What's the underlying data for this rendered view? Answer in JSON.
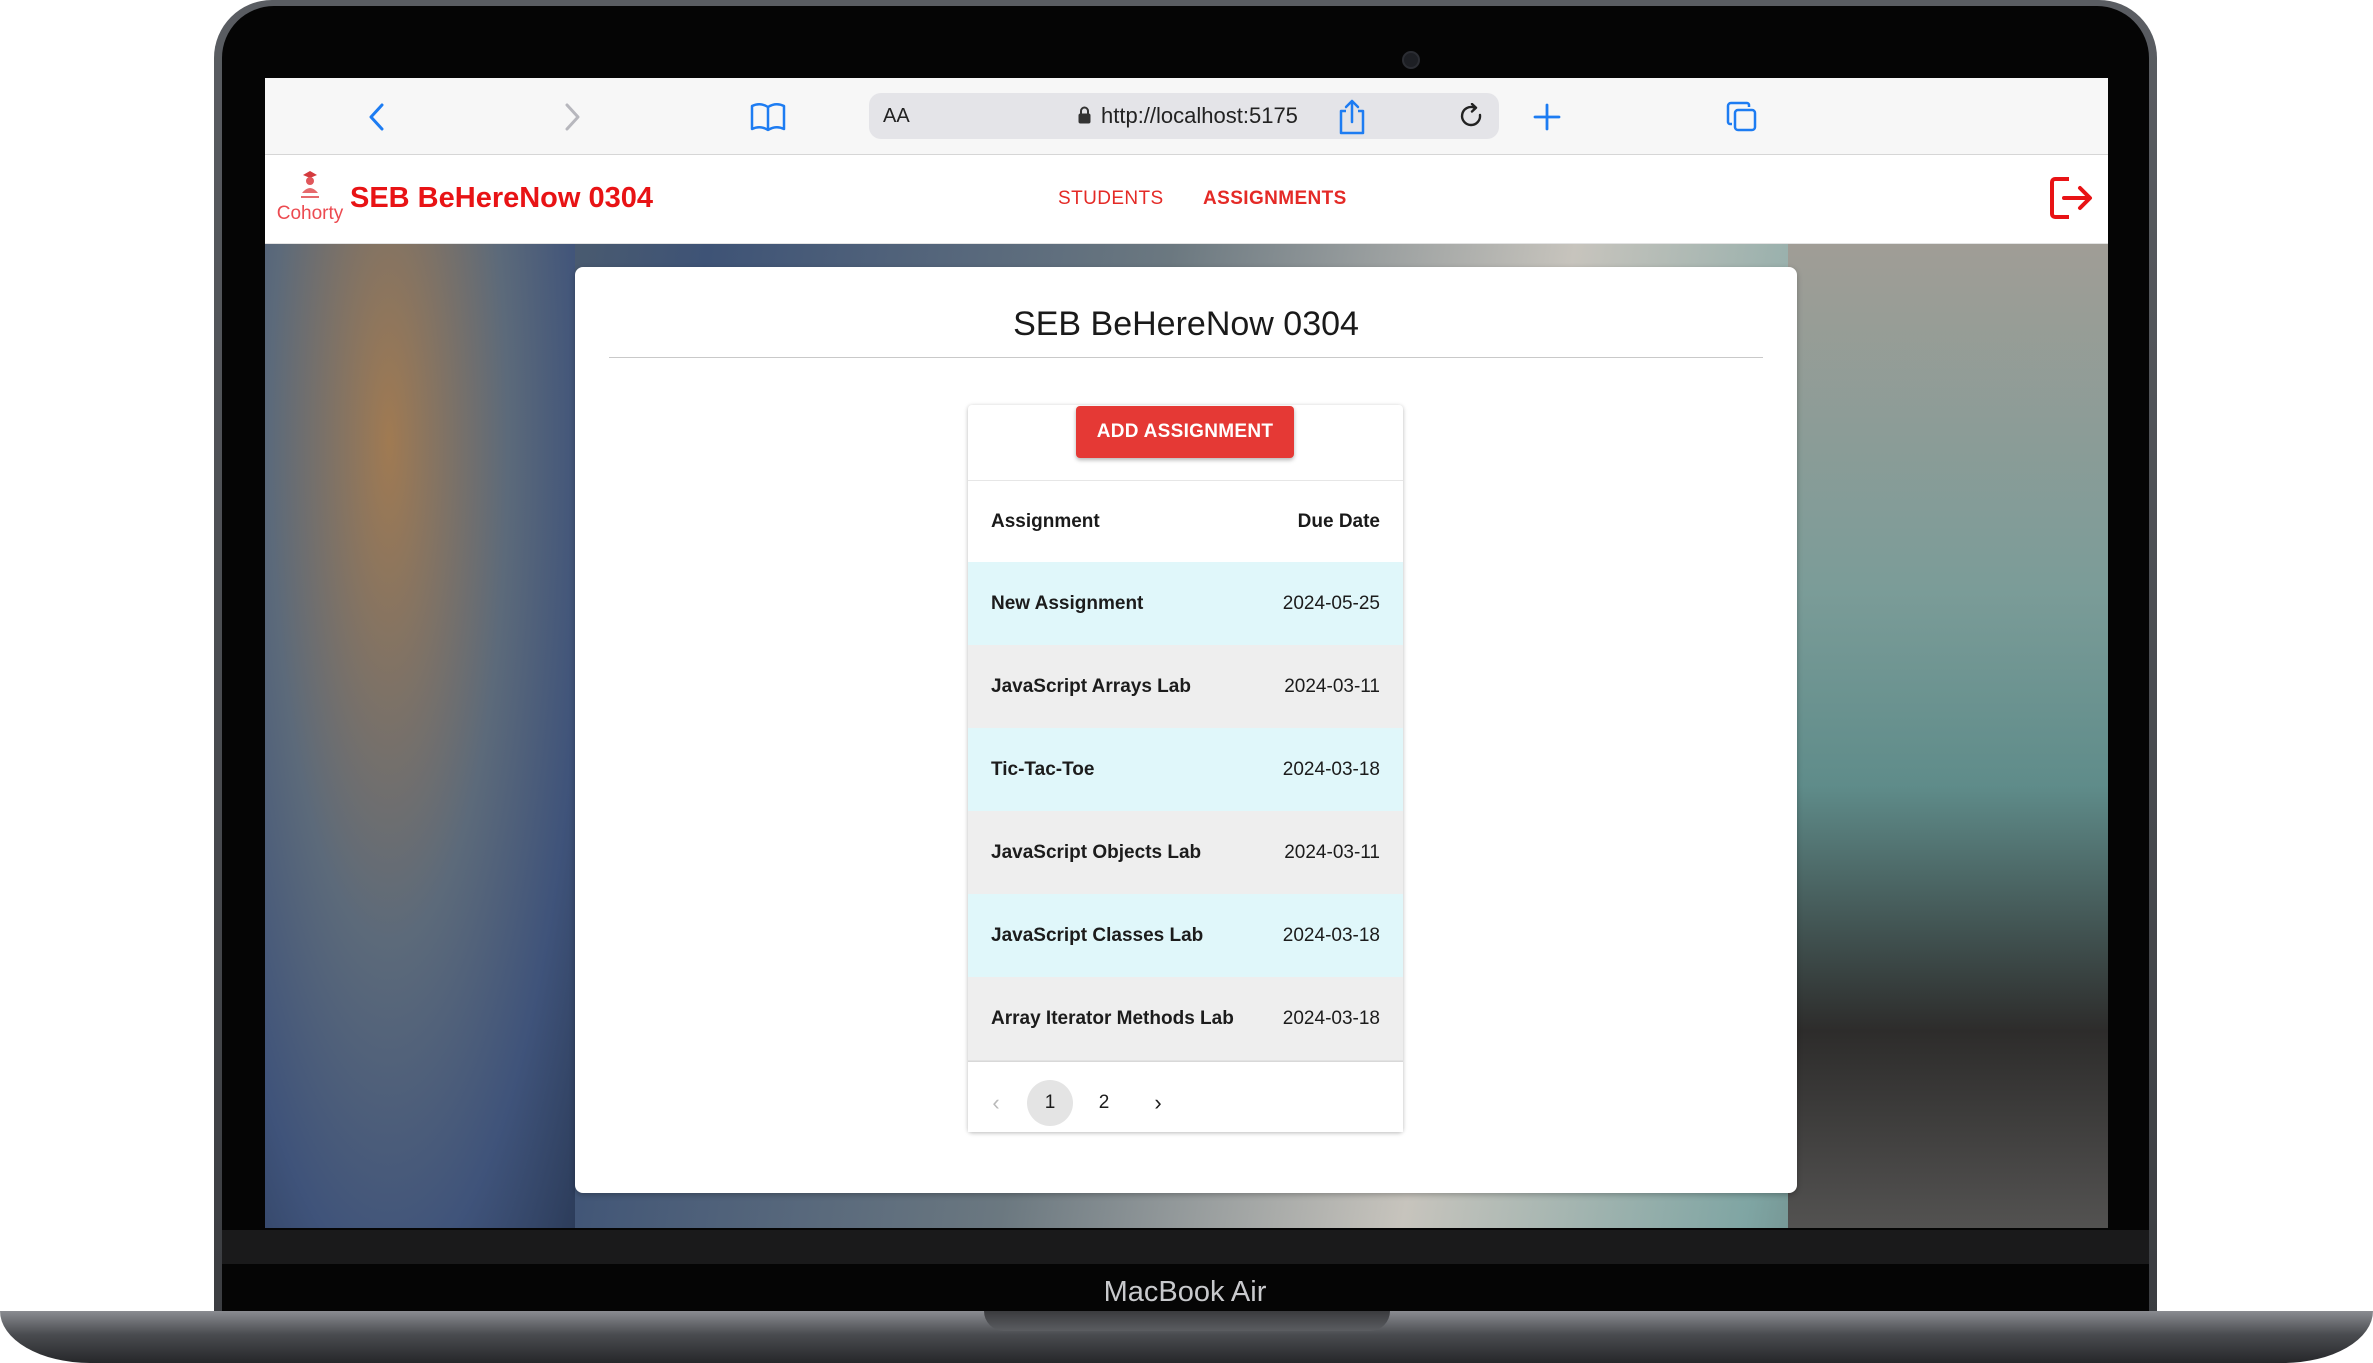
{
  "device": {
    "brand_label": "MacBook Air"
  },
  "browser": {
    "text_size_label": "AA",
    "url": "http://localhost:5175",
    "icons": [
      "back-icon",
      "forward-icon",
      "bookmarks-icon",
      "lock-icon",
      "reload-icon",
      "share-icon",
      "new-tab-icon",
      "tabs-icon"
    ]
  },
  "app": {
    "logo_text": "Cohorty",
    "title": "SEB BeHereNow 0304",
    "nav": {
      "students": "STUDENTS",
      "assignments": "ASSIGNMENTS"
    },
    "accent_color": "#e81315"
  },
  "main": {
    "card_title": "SEB BeHereNow 0304",
    "add_button_label": "ADD ASSIGNMENT",
    "table": {
      "headers": {
        "assignment": "Assignment",
        "due_date": "Due Date"
      },
      "rows": [
        {
          "name": "New Assignment",
          "due": "2024-05-25"
        },
        {
          "name": "JavaScript Arrays Lab",
          "due": "2024-03-11"
        },
        {
          "name": "Tic-Tac-Toe",
          "due": "2024-03-18"
        },
        {
          "name": "JavaScript Objects Lab",
          "due": "2024-03-11"
        },
        {
          "name": "JavaScript Classes Lab",
          "due": "2024-03-18"
        },
        {
          "name": "Array Iterator Methods Lab",
          "due": "2024-03-18"
        }
      ],
      "row_colors": [
        "#e0f7fa",
        "#eeeeee"
      ]
    },
    "pagination": {
      "prev": "‹",
      "pages": [
        "1",
        "2"
      ],
      "current_page": "1",
      "next": "›"
    }
  }
}
